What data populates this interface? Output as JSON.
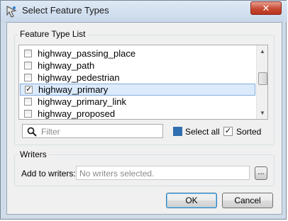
{
  "window": {
    "title": "Select Feature Types",
    "close_label": "✕"
  },
  "feature_group": {
    "label": "Feature Type List",
    "items": [
      {
        "label": "highway_passing_place",
        "checked": false,
        "selected": false
      },
      {
        "label": "highway_path",
        "checked": false,
        "selected": false
      },
      {
        "label": "highway_pedestrian",
        "checked": false,
        "selected": false
      },
      {
        "label": "highway_primary",
        "checked": true,
        "selected": true
      },
      {
        "label": "highway_primary_link",
        "checked": false,
        "selected": false
      },
      {
        "label": "highway_proposed",
        "checked": false,
        "selected": false
      }
    ],
    "filter_placeholder": "Filter",
    "select_all_label": "Select all",
    "select_all_checked": false,
    "sorted_label": "Sorted",
    "sorted_checked": true
  },
  "writers_group": {
    "label": "Writers",
    "add_to_writers_label": "Add to writers:",
    "writers_value": "No writers selected.",
    "browse_label": "..."
  },
  "buttons": {
    "ok_label": "OK",
    "cancel_label": "Cancel"
  },
  "icons": {
    "app": "feature-types-icon",
    "search": "search-icon"
  }
}
